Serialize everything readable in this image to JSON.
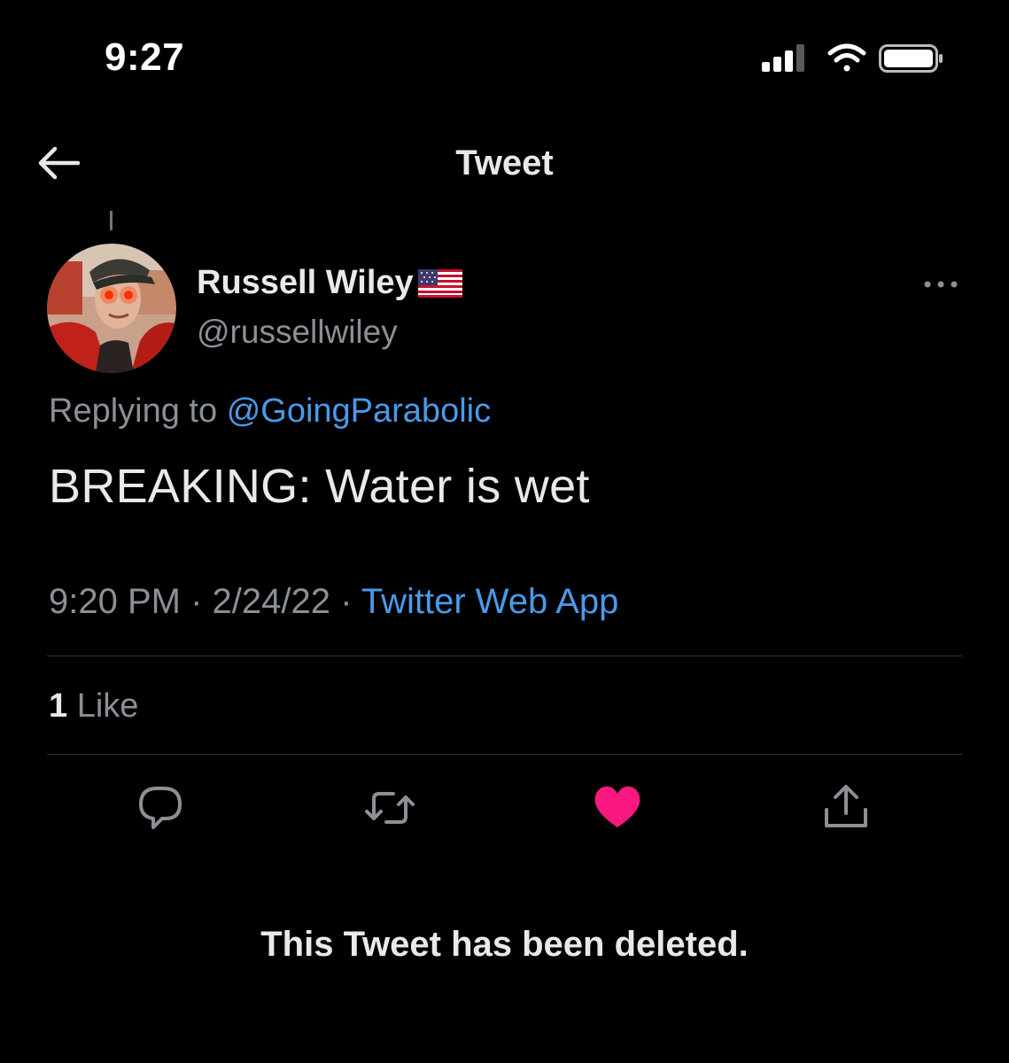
{
  "status_bar": {
    "time": "9:27"
  },
  "header": {
    "title": "Tweet"
  },
  "tweet": {
    "author_name": "Russell Wiley",
    "author_handle": "@russellwiley",
    "replying_prefix": "Replying to",
    "replying_to": "@GoingParabolic",
    "text": "BREAKING: Water is wet",
    "time": "9:20 PM",
    "separator": "·",
    "date": "2/24/22",
    "source": "Twitter Web App",
    "like_count": "1",
    "like_label": "Like"
  },
  "notice": {
    "deleted": "This Tweet has been deleted."
  },
  "colors": {
    "background": "#000000",
    "link": "#4a9ae9",
    "like_active": "#f91880",
    "muted": "#8b9096"
  },
  "icons": {
    "back": "arrow-left-icon",
    "more": "more-horizontal-icon",
    "reply": "reply-icon",
    "retweet": "retweet-icon",
    "like": "heart-icon",
    "share": "share-icon"
  }
}
